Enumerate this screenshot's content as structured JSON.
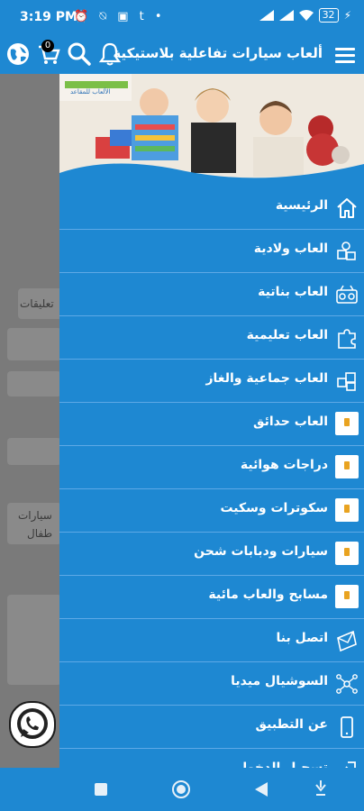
{
  "status_bar": {
    "time": "3:19 PM",
    "left_icons": "⏰ ⍉ ▣ t •",
    "battery": "32"
  },
  "toolbar": {
    "title": "ألعاب سيارات تفاعلية بلاستيكية",
    "cart_count": "0"
  },
  "background_page": {
    "tab_label": "تعليقات",
    "card_text_1": "سيارات",
    "card_text_2": "طفال"
  },
  "drawer": {
    "header_logo_text": "الألعاب للمقاعد",
    "items": [
      {
        "label": "الرئيسية",
        "icon": "home-icon"
      },
      {
        "label": "العاب ولادية",
        "icon": "baby-toys-icon"
      },
      {
        "label": "العاب بناتية",
        "icon": "doll-toys-icon"
      },
      {
        "label": "العاب تعليمية",
        "icon": "puzzle-icon"
      },
      {
        "label": "العاب جماعية والغاز",
        "icon": "blocks-icon"
      },
      {
        "label": "العاب حدائق",
        "icon": "category-thumbnail"
      },
      {
        "label": "دراجات هوائية",
        "icon": "category-thumbnail"
      },
      {
        "label": "سكوترات وسكيت",
        "icon": "category-thumbnail"
      },
      {
        "label": "سيارات ودبابات شحن",
        "icon": "category-thumbnail"
      },
      {
        "label": "مسابح والعاب مائية",
        "icon": "category-thumbnail"
      },
      {
        "label": "اتصل بنا",
        "icon": "mail-icon"
      },
      {
        "label": "السوشيال ميديا",
        "icon": "share-network-icon"
      },
      {
        "label": "عن التطبيق",
        "icon": "phone-icon"
      },
      {
        "label": "تسجيل الدخول",
        "icon": "login-icon"
      }
    ]
  },
  "colors": {
    "primary": "#1e88d2",
    "divider": "#5ea9e6"
  }
}
